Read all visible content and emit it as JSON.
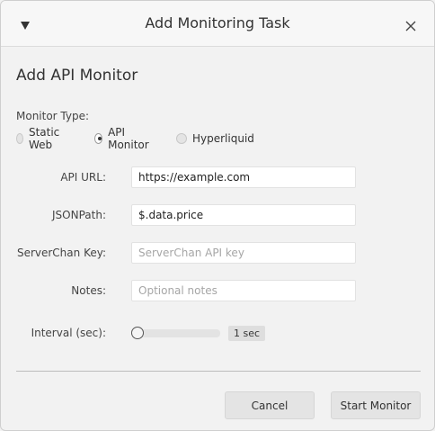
{
  "window": {
    "title": "Add Monitoring Task"
  },
  "icons": {
    "menu": "triangle-down-icon",
    "close": "close-icon"
  },
  "section": {
    "title": "Add API Monitor"
  },
  "monitor_type": {
    "label": "Monitor Type:",
    "options": [
      {
        "label": "Static Web",
        "checked": false
      },
      {
        "label": "API Monitor",
        "checked": true
      },
      {
        "label": "Hyperliquid",
        "checked": false
      }
    ]
  },
  "fields": {
    "api_url": {
      "label": "API URL:",
      "value": "https://example.com",
      "placeholder": ""
    },
    "jsonpath": {
      "label": "JSONPath:",
      "value": "$.data.price",
      "placeholder": ""
    },
    "serverchan": {
      "label": "ServerChan Key:",
      "value": "",
      "placeholder": "ServerChan API key"
    },
    "notes": {
      "label": "Notes:",
      "value": "",
      "placeholder": "Optional notes"
    }
  },
  "interval": {
    "label": "Interval (sec):",
    "value_text": "1 sec",
    "level": 0
  },
  "buttons": {
    "cancel": "Cancel",
    "start": "Start Monitor"
  },
  "colors": {
    "background": "#f2f2f2",
    "field_bg": "#ffffff",
    "button_bg": "#e4e4e4"
  }
}
